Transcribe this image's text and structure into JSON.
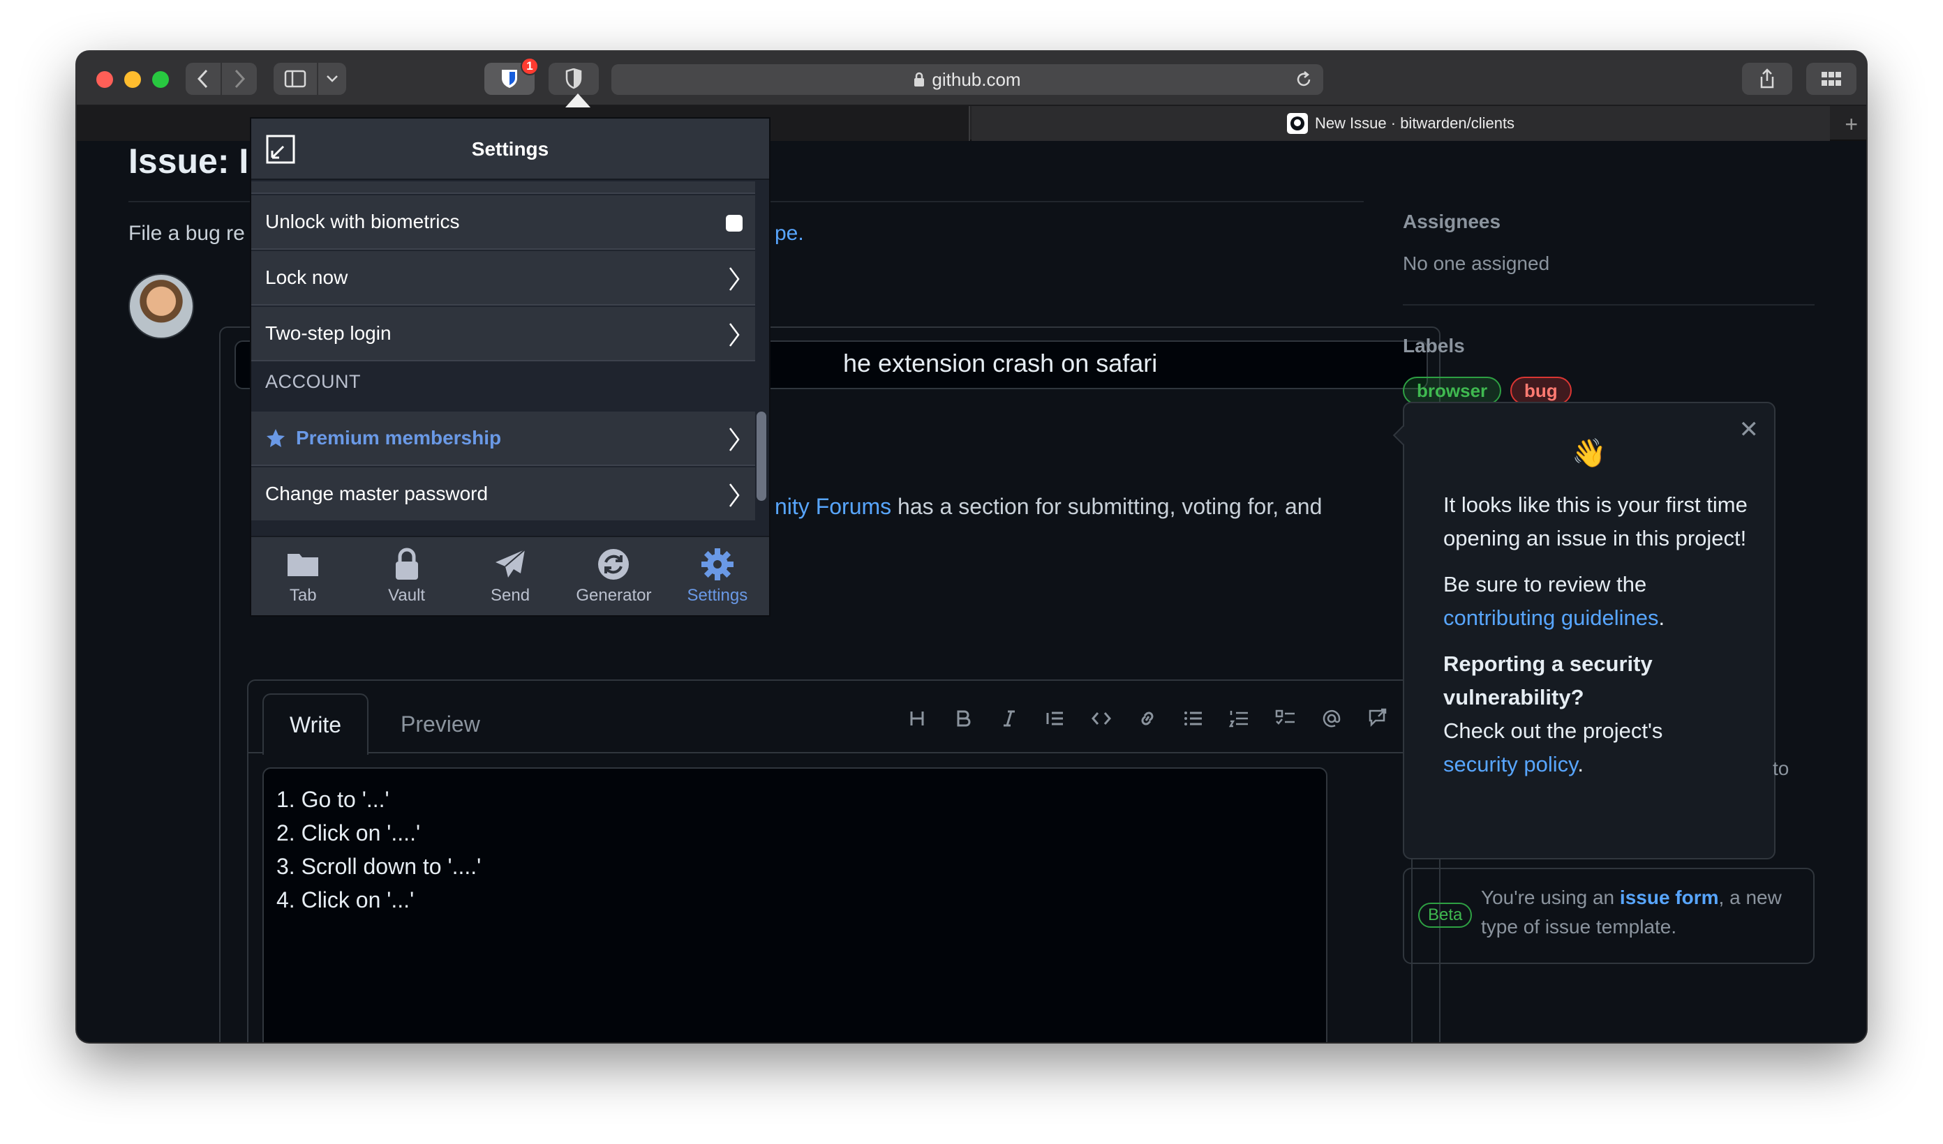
{
  "browser": {
    "address": "github.com",
    "extension_badge": "1",
    "tab_title": "New Issue · bitwarden/clients"
  },
  "issue": {
    "title": "Issue: I",
    "intro": "File a bug re",
    "intro_link": "pe.",
    "title_input_value": "he extension crash on safari",
    "forum_link": "nity Forums",
    "forum_text": " has a section for submitting, voting for, and",
    "editor": {
      "write_tab": "Write",
      "preview_tab": "Preview",
      "lines": [
        "1. Go to '...'",
        "2. Click on '....'",
        "3. Scroll down to '....'",
        "4. Click on '...'"
      ]
    }
  },
  "sidebar": {
    "assignees_heading": "Assignees",
    "assignees_value": "No one assigned",
    "labels_heading": "Labels",
    "labels": [
      {
        "name": "browser",
        "color": "#3fb950"
      },
      {
        "name": "bug",
        "color": "#ff7b72"
      }
    ],
    "popover": {
      "emoji": "👋",
      "p1": "It looks like this is your first time opening an issue in this project!",
      "p2_before": "Be sure to review the ",
      "p2_link": "contributing guidelines",
      "p2_after": ".",
      "p3_strong": "Reporting a security vulnerability?",
      "p3_text": "Check out the project's ",
      "p3_link": "security policy",
      "p3_after": "."
    },
    "partial_text": "to",
    "beta": {
      "pill": "Beta",
      "text_before": "You're using an ",
      "link": "issue form",
      "text_after": ", a new type of issue template."
    }
  },
  "bitwarden": {
    "header_title": "Settings",
    "rows": {
      "unlock_biometrics": "Unlock with biometrics",
      "lock_now": "Lock now",
      "two_step": "Two-step login",
      "section_account": "ACCOUNT",
      "premium": "Premium membership",
      "change_password": "Change master password"
    },
    "nav": [
      {
        "label": "Tab",
        "icon": "folder-icon",
        "active": false
      },
      {
        "label": "Vault",
        "icon": "lock-icon",
        "active": false
      },
      {
        "label": "Send",
        "icon": "paper-plane-icon",
        "active": false
      },
      {
        "label": "Generator",
        "icon": "refresh-icon",
        "active": false
      },
      {
        "label": "Settings",
        "icon": "gear-icon",
        "active": true
      }
    ],
    "accent_color": "#6a99e6"
  }
}
